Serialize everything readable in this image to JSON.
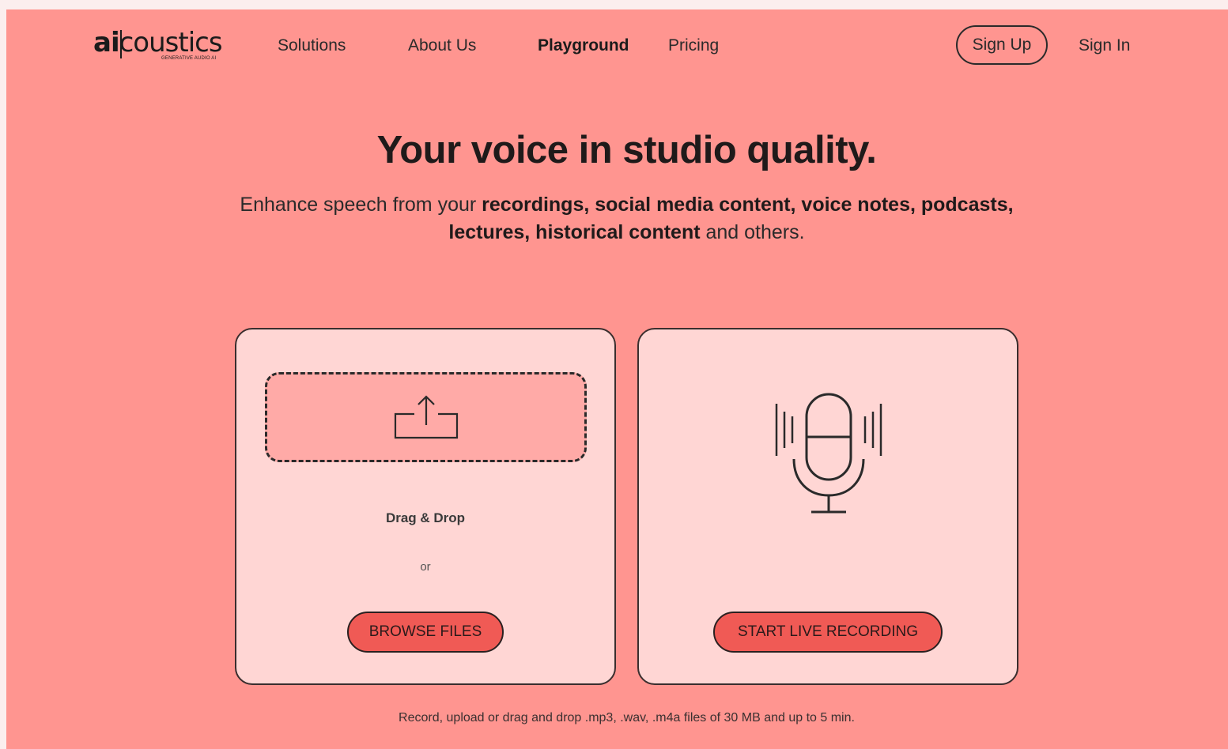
{
  "header": {
    "logo": {
      "prefix": "ai",
      "suffix": "coustics",
      "tagline": "GENERATIVE AUDIO AI"
    },
    "nav": {
      "solutions": "Solutions",
      "about": "About Us",
      "playground": "Playground",
      "pricing": "Pricing"
    },
    "sign_up": "Sign Up",
    "sign_in": "Sign In"
  },
  "hero": {
    "title": "Your voice in studio quality.",
    "subtitle": {
      "lead": "Enhance speech from your ",
      "items_line1": "recordings, social media content, voice notes, podcasts,",
      "items_line2": "lectures, historical content",
      "tail": " and others."
    }
  },
  "upload_card": {
    "icon": "upload-icon",
    "drag_label": "Drag & Drop",
    "or_label": "or",
    "button_label": "BROWSE FILES"
  },
  "record_card": {
    "icon": "microphone-icon",
    "button_label": "START LIVE RECORDING"
  },
  "footnote": "Record, upload or drag and drop .mp3, .wav, .m4a files of 30 MB and up to 5 min.",
  "colors": {
    "background": "#ff9590",
    "card": "#ffd6d4",
    "dropzone": "#ffaaa7",
    "button": "#f05a55",
    "text": "#1f1a1a"
  }
}
